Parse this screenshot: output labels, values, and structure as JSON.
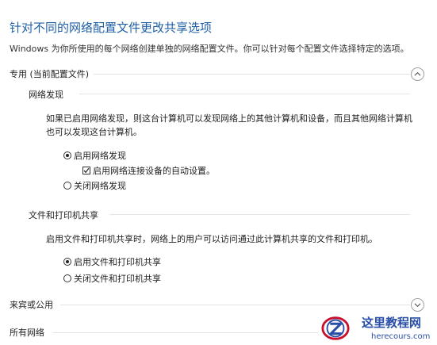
{
  "header": {
    "title": "针对不同的网络配置文件更改共享选项",
    "subtitle": "Windows 为你所使用的每个网络创建单独的网络配置文件。你可以针对每个配置文件选择特定的选项。"
  },
  "sections": [
    {
      "label": "专用 (当前配置文件)",
      "expanded": true,
      "subsections": [
        {
          "label": "网络发现",
          "description": "如果已启用网络发现，则这台计算机可以发现网络上的其他计算机和设备，而且其他网络计算机也可以发现这台计算机。",
          "options": [
            {
              "label": "启用网络发现",
              "selected": true
            },
            {
              "label": "启用网络连接设备的自动设置。",
              "checked": true
            },
            {
              "label": "关闭网络发现",
              "selected": false
            }
          ]
        },
        {
          "label": "文件和打印机共享",
          "description": "启用文件和打印机共享时，网络上的用户可以访问通过此计算机共享的文件和打印机。",
          "options": [
            {
              "label": "启用文件和打印机共享",
              "selected": true
            },
            {
              "label": "关闭文件和打印机共享",
              "selected": false
            }
          ]
        }
      ]
    },
    {
      "label": "来宾或公用",
      "expanded": false
    },
    {
      "label": "所有网络",
      "expanded": false
    }
  ],
  "watermark": {
    "title": "这里教程网",
    "url": "herecours.com"
  },
  "colors": {
    "title": "#1f5fa6",
    "divider": "#e3e3e3",
    "watermark": "#2a4fa8"
  }
}
